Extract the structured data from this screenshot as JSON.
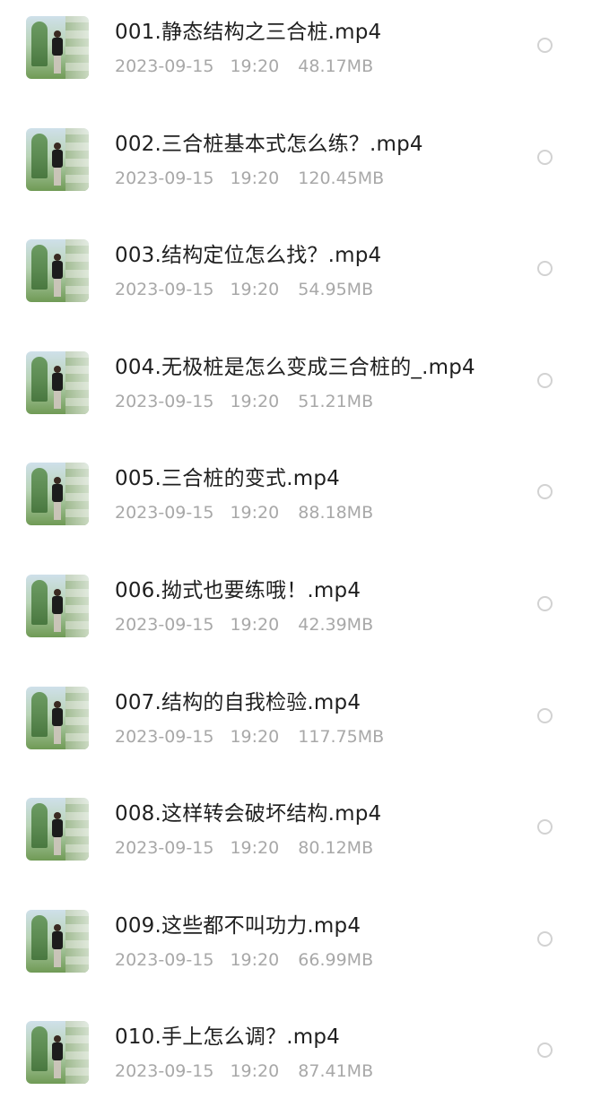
{
  "files": [
    {
      "name": "001.静态结构之三合桩.mp4",
      "date": "2023-09-15",
      "time": "19:20",
      "size": "48.17MB",
      "thumbnail": "video-thumbnail"
    },
    {
      "name": "002.三合桩基本式怎么练？.mp4",
      "date": "2023-09-15",
      "time": "19:20",
      "size": "120.45MB",
      "thumbnail": "video-thumbnail"
    },
    {
      "name": "003.结构定位怎么找？.mp4",
      "date": "2023-09-15",
      "time": "19:20",
      "size": "54.95MB",
      "thumbnail": "video-thumbnail"
    },
    {
      "name": "004.无极桩是怎么变成三合桩的_.mp4",
      "date": "2023-09-15",
      "time": "19:20",
      "size": "51.21MB",
      "thumbnail": "video-thumbnail"
    },
    {
      "name": "005.三合桩的变式.mp4",
      "date": "2023-09-15",
      "time": "19:20",
      "size": "88.18MB",
      "thumbnail": "video-thumbnail"
    },
    {
      "name": "006.拗式也要练哦！.mp4",
      "date": "2023-09-15",
      "time": "19:20",
      "size": "42.39MB",
      "thumbnail": "video-thumbnail"
    },
    {
      "name": "007.结构的自我检验.mp4",
      "date": "2023-09-15",
      "time": "19:20",
      "size": "117.75MB",
      "thumbnail": "video-thumbnail"
    },
    {
      "name": "008.这样转会破坏结构.mp4",
      "date": "2023-09-15",
      "time": "19:20",
      "size": "80.12MB",
      "thumbnail": "video-thumbnail"
    },
    {
      "name": "009.这些都不叫功力.mp4",
      "date": "2023-09-15",
      "time": "19:20",
      "size": "66.99MB",
      "thumbnail": "video-thumbnail"
    },
    {
      "name": "010.手上怎么调？.mp4",
      "date": "2023-09-15",
      "time": "19:20",
      "size": "87.41MB",
      "thumbnail": "video-thumbnail"
    }
  ],
  "colors": {
    "name_text": "#1f1f1f",
    "meta_text": "#a8a8a8",
    "radio_border": "#d2d2d2",
    "background": "#ffffff"
  }
}
